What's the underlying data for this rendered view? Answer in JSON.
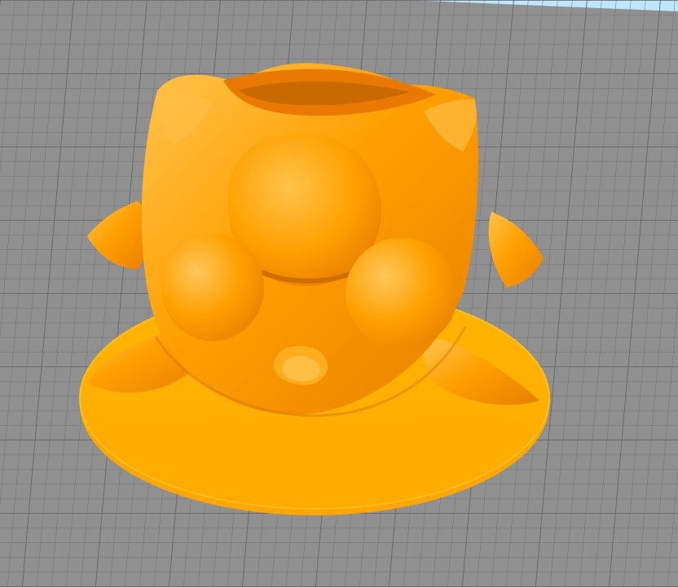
{
  "viewer": {
    "background_color": "#8f8f8f",
    "sky_color": "#bfe6ff",
    "grid_line_color": "#6f6f6f",
    "grid_major_color": "#5f5f5f"
  },
  "model": {
    "name": "",
    "color": "#ff9f00",
    "highlight_color": "#ffc04a",
    "shadow_color": "#e07c00",
    "base_color": "#ffb000",
    "icons": [
      "orange-3d-model-icon"
    ]
  }
}
